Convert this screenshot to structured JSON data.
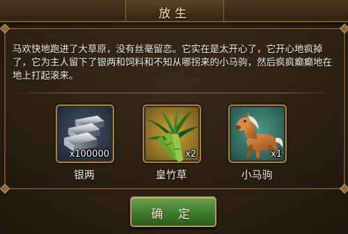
{
  "dialog": {
    "title": "放生",
    "message": "马欢快地跑进了大草原，没有丝毫留恋。它实在是太开心了，它开心地疯掉了，它为主人留下了银两和饲料和不知从哪拐来的小马驹，然后疯疯癫癫地在地上打起滚来。",
    "confirm_label": "确 定"
  },
  "rewards": [
    {
      "name": "银两",
      "quantity": "x100000",
      "icon": "silver-ingots-icon"
    },
    {
      "name": "皇竹草",
      "quantity": "x2",
      "icon": "bamboo-grass-icon"
    },
    {
      "name": "小马驹",
      "quantity": "x1",
      "icon": "pony-icon"
    }
  ],
  "colors": {
    "title_text": "#f4e6c2",
    "message_text": "#f2efe6",
    "frame_border": "#6b4f2a",
    "confirm_button": "#3f7a2c"
  }
}
